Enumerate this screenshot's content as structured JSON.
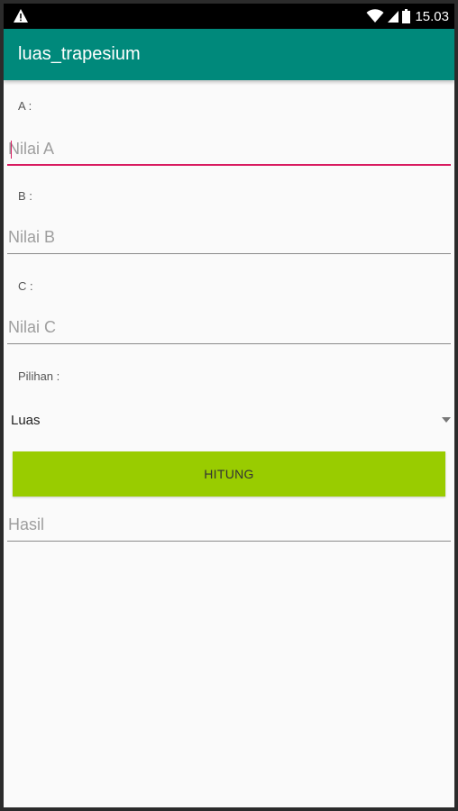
{
  "status_bar": {
    "time": "15.03",
    "icons": [
      "warning-icon",
      "wifi-icon",
      "signal-icon",
      "battery-icon"
    ]
  },
  "app_bar": {
    "title": "luas_trapesium",
    "color": "#00897b"
  },
  "form": {
    "a_label": "A :",
    "a_placeholder": "Nilai A",
    "b_label": "B :",
    "b_placeholder": "Nilai B",
    "c_label": "C :",
    "c_placeholder": "Nilai C",
    "choice_label": "Pilihan :",
    "choice_value": "Luas",
    "button_label": "HITUNG",
    "button_color": "#99cc00",
    "result_placeholder": "Hasil",
    "accent_color": "#d81b60"
  }
}
